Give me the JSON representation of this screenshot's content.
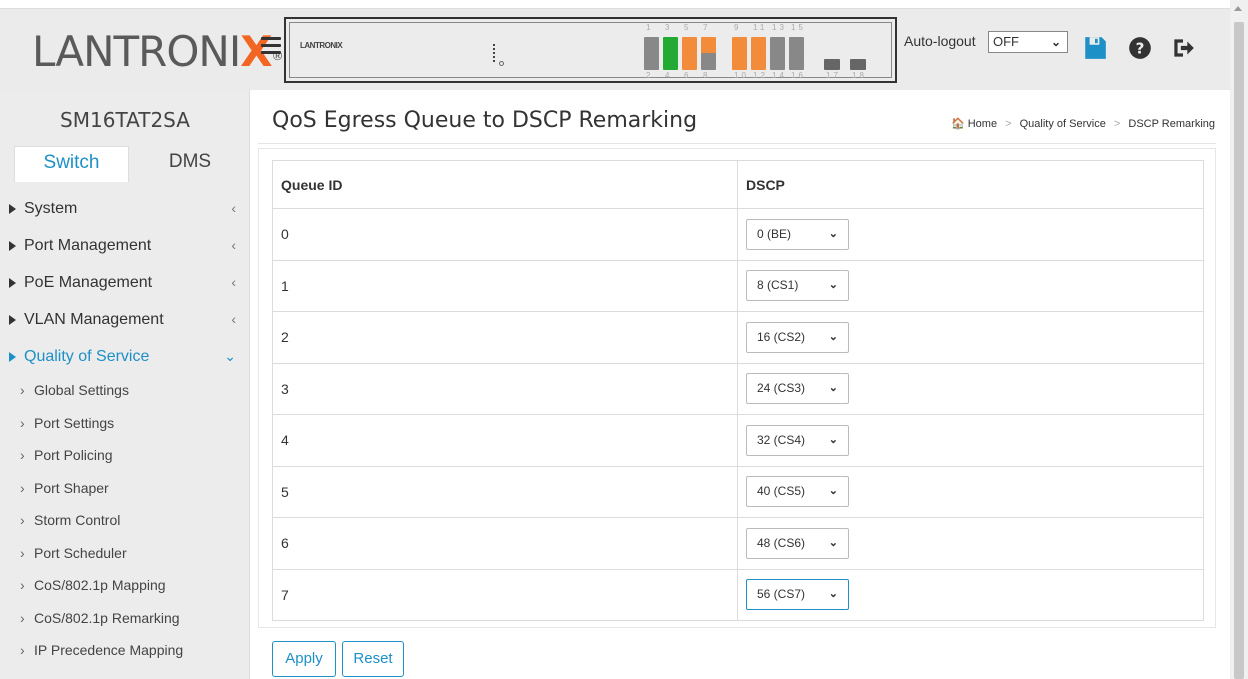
{
  "header": {
    "logo_text": "LANTRONIX",
    "logo_reg": "®",
    "device_logo": "LANTRONIX",
    "port_nums_top": [
      "1",
      "3",
      "5",
      "7",
      "9",
      "11",
      "13",
      "15"
    ],
    "port_nums_bottom": [
      "2",
      "4",
      "6",
      "8",
      "10",
      "12",
      "14",
      "16",
      "17",
      "18"
    ],
    "autologout_label": "Auto-logout",
    "autologout_value": "OFF",
    "icons": [
      "save-icon",
      "help-icon",
      "logout-icon"
    ]
  },
  "sidebar": {
    "device_name": "SM16TAT2SA",
    "tabs": [
      {
        "label": "Switch",
        "active": true
      },
      {
        "label": "DMS",
        "active": false
      }
    ],
    "nav": [
      {
        "label": "System"
      },
      {
        "label": "Port Management"
      },
      {
        "label": "PoE Management"
      },
      {
        "label": "VLAN Management"
      },
      {
        "label": "Quality of Service",
        "active": true
      }
    ],
    "sub_items": [
      "Global Settings",
      "Port Settings",
      "Port Policing",
      "Port Shaper",
      "Storm Control",
      "Port Scheduler",
      "CoS/802.1p Mapping",
      "CoS/802.1p Remarking",
      "IP Precedence Mapping"
    ]
  },
  "main": {
    "title": "QoS Egress Queue to DSCP Remarking",
    "breadcrumb": [
      "Home",
      "Quality of Service",
      "DSCP Remarking"
    ],
    "table": {
      "headers": [
        "Queue ID",
        "DSCP"
      ],
      "rows": [
        {
          "queue": "0",
          "dscp": "0 (BE)"
        },
        {
          "queue": "1",
          "dscp": "8 (CS1)"
        },
        {
          "queue": "2",
          "dscp": "16 (CS2)"
        },
        {
          "queue": "3",
          "dscp": "24 (CS3)"
        },
        {
          "queue": "4",
          "dscp": "32 (CS4)"
        },
        {
          "queue": "5",
          "dscp": "40 (CS5)"
        },
        {
          "queue": "6",
          "dscp": "48 (CS6)"
        },
        {
          "queue": "7",
          "dscp": "56 (CS7)"
        }
      ]
    },
    "apply_label": "Apply",
    "reset_label": "Reset"
  },
  "colors": {
    "accent": "#1e90c8",
    "brand_orange": "#f26522",
    "port_green": "#22aa33",
    "port_orange": "#f28c3a"
  }
}
